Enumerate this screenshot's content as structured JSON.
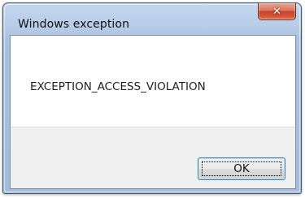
{
  "window": {
    "title": "Windows exception",
    "close_icon": "close-icon"
  },
  "dialog": {
    "message": "EXCEPTION_ACCESS_VIOLATION",
    "ok_label": "OK"
  },
  "colors": {
    "close_button": "#c7432a",
    "frame": "#a9c1e1",
    "button_area": "#f0f0f0"
  }
}
